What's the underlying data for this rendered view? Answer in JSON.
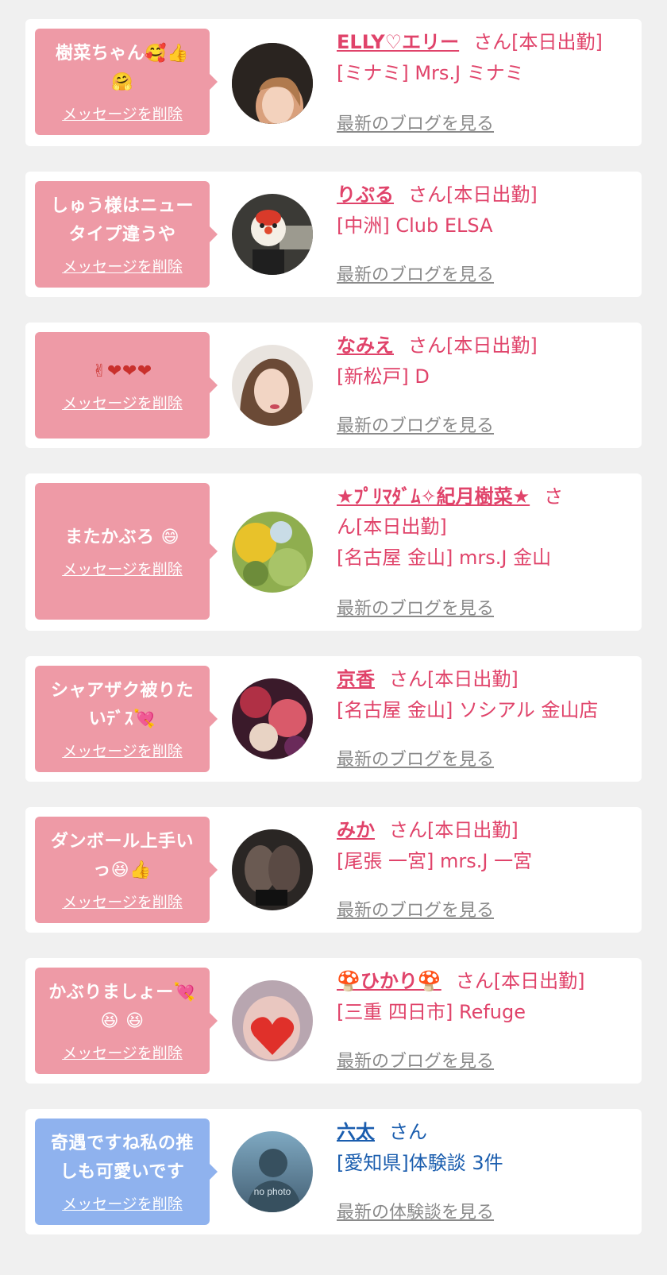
{
  "delete_label": "メッセージを削除",
  "colors": {
    "pink": "#ee9aa6",
    "blue": "#8fb2ee",
    "name_pink": "#e0436a",
    "name_blue": "#1a5dae",
    "link_gray": "#8a8a8a"
  },
  "cards": [
    {
      "message_lines": [
        "樹菜ちゃん🥰👍",
        "🤗"
      ],
      "name": "ELLY♡エリー",
      "suffix": "さん[本日出勤]",
      "shop": "[ミナミ] Mrs.J ミナミ",
      "link": "最新のブログを見る",
      "avatar": "avatar-woman-blonde"
    },
    {
      "message_lines": [
        "しゅう様はニュー",
        "タイプ違うや"
      ],
      "name": "りぷる",
      "suffix": "さん[本日出勤]",
      "shop": "[中洲] Club ELSA",
      "link": "最新のブログを見る",
      "avatar": "avatar-mask"
    },
    {
      "message_lines": [
        "✌❤❤❤"
      ],
      "name": "なみえ",
      "suffix": "さん[本日出勤]",
      "shop": "[新松戸] D",
      "link": "最新のブログを見る",
      "avatar": "avatar-woman"
    },
    {
      "message_lines": [
        "またかぶろ 😄"
      ],
      "name": "★ﾌﾟﾘﾏﾀﾞﾑ✧紀月樹菜★",
      "suffix": "さ",
      "suffix2": "ん[本日出勤]",
      "shop": "[名古屋 金山] mrs.J 金山",
      "link": "最新のブログを見る",
      "avatar": "avatar-flower"
    },
    {
      "message_lines": [
        "シャアザク被りた",
        "いﾃﾞｽ💘"
      ],
      "name": "京香",
      "suffix": "さん[本日出勤]",
      "shop": "[名古屋 金山] ソシアル 金山店",
      "link": "最新のブログを見る",
      "avatar": "avatar-kimono"
    },
    {
      "message_lines": [
        "ダンボール上手い",
        "っ😆👍"
      ],
      "name": "みか",
      "suffix": "さん[本日出勤]",
      "shop": "[尾張 一宮] mrs.J 一宮",
      "link": "最新のブログを見る",
      "avatar": "avatar-legs"
    },
    {
      "message_lines": [
        "かぶりましょー💘",
        "😆 😆"
      ],
      "name": "🍄ひかり🍄",
      "suffix": "さん[本日出勤]",
      "shop": "[三重 四日市] Refuge",
      "link": "最新のブログを見る",
      "avatar": "avatar-heart-face"
    },
    {
      "message_lines": [
        "奇遇ですね私の推",
        "しも可愛いです"
      ],
      "name": "六太",
      "suffix": "さん",
      "shop": "[愛知県]体験談 3件",
      "link": "最新の体験談を見る",
      "avatar": "avatar-nophoto",
      "avatar_text": "no photo",
      "blue": true
    }
  ]
}
